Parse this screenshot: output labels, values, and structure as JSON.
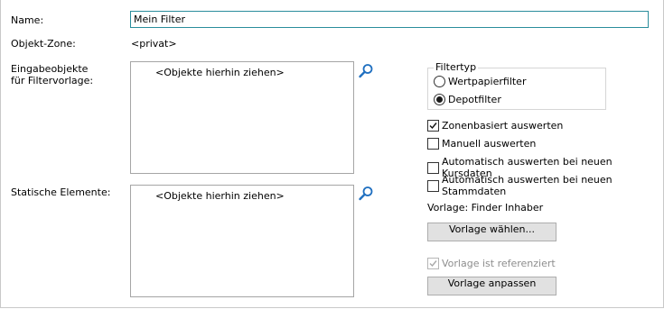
{
  "form": {
    "name_label": "Name:",
    "name_value": "Mein Filter",
    "zone_label": "Objekt-Zone:",
    "zone_value": "<privat>",
    "input_objects_label_line1": "Eingabeobjekte",
    "input_objects_label_line2": "für Filtervorlage:",
    "input_objects_placeholder": "<Objekte hierhin ziehen>",
    "static_elements_label": "Statische Elemente:",
    "static_elements_placeholder": "<Objekte hierhin ziehen>"
  },
  "filtertyp": {
    "legend": "Filtertyp",
    "options": [
      {
        "label": "Wertpapierfilter",
        "checked": false
      },
      {
        "label": "Depotfilter",
        "checked": true
      }
    ]
  },
  "options": {
    "zonenbasiert": {
      "label": "Zonenbasiert auswerten",
      "checked": true
    },
    "manuell": {
      "label": "Manuell auswerten",
      "checked": false
    },
    "auto_kurs": {
      "label": "Automatisch auswerten bei neuen Kursdaten",
      "checked": false
    },
    "auto_stamm": {
      "label": "Automatisch auswerten bei neuen Stammdaten",
      "checked": false
    }
  },
  "vorlage": {
    "label": "Vorlage: Finder Inhaber",
    "choose_button": "Vorlage wählen...",
    "referenced_label": "Vorlage ist referenziert",
    "referenced_checked": true,
    "adjust_button": "Vorlage anpassen"
  },
  "icons": {
    "search": "magnifier-icon"
  },
  "colors": {
    "focus_border": "#2a8d9c",
    "magnifier": "#1f6fc0"
  }
}
